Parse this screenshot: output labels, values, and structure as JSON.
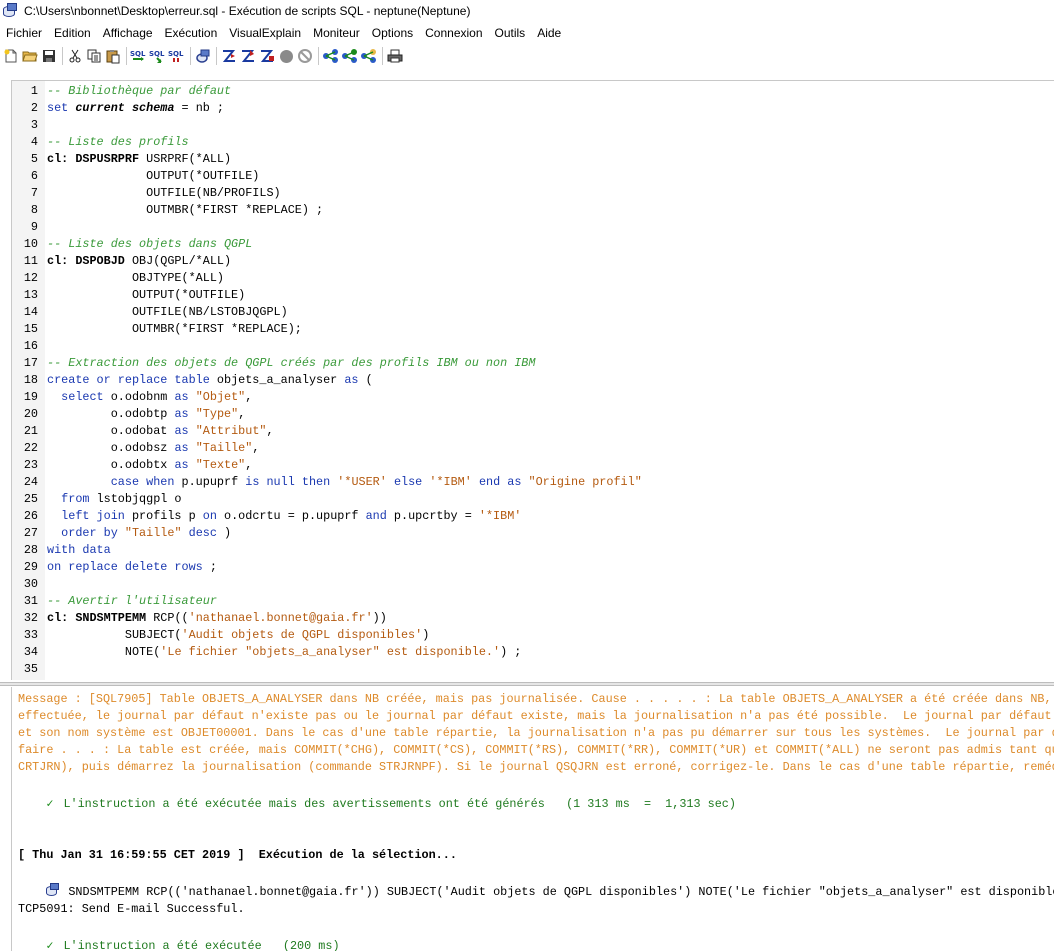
{
  "window": {
    "title": "C:\\Users\\nbonnet\\Desktop\\erreur.sql - Exécution de scripts SQL - neptune(Neptune)"
  },
  "menu": [
    "Fichier",
    "Edition",
    "Affichage",
    "Exécution",
    "VisualExplain",
    "Moniteur",
    "Options",
    "Connexion",
    "Outils",
    "Aide"
  ],
  "toolbar": {
    "sql_label": "SQL",
    "icons": [
      "new-file-icon",
      "open-folder-icon",
      "save-icon",
      "cut-icon",
      "copy-icon",
      "paste-icon",
      "run-all-icon",
      "run-from-selection-icon",
      "run-selected-icon",
      "connection-icon",
      "explain-icon",
      "explain-run-icon",
      "explain-selected-icon",
      "stop-icon",
      "cancel-icon",
      "visual-explain-icon",
      "visual-explain-run-icon",
      "visual-explain-selected-icon",
      "print-icon"
    ]
  },
  "editor": {
    "lines": [
      [
        [
          "cm",
          "-- Bibliothèque par défaut"
        ]
      ],
      [
        [
          "kw",
          "set "
        ],
        [
          "cl it bold",
          "current schema"
        ],
        [
          "tx",
          " = nb ;"
        ]
      ],
      [],
      [
        [
          "cm",
          "-- Liste des profils"
        ]
      ],
      [
        [
          "cl bold",
          "cl: DSPUSRPRF"
        ],
        [
          "tx",
          " USRPRF(*ALL)"
        ]
      ],
      [
        [
          "tx",
          "              OUTPUT(*OUTFILE)"
        ]
      ],
      [
        [
          "tx",
          "              OUTFILE(NB/PROFILS)"
        ]
      ],
      [
        [
          "tx",
          "              OUTMBR(*FIRST *REPLACE) ;"
        ]
      ],
      [],
      [
        [
          "cm",
          "-- Liste des objets dans QGPL"
        ]
      ],
      [
        [
          "cl bold",
          "cl: DSPOBJD"
        ],
        [
          "tx",
          " OBJ(QGPL/*ALL)"
        ]
      ],
      [
        [
          "tx",
          "            OBJTYPE(*ALL)"
        ]
      ],
      [
        [
          "tx",
          "            OUTPUT(*OUTFILE)"
        ]
      ],
      [
        [
          "tx",
          "            OUTFILE(NB/LSTOBJQGPL)"
        ]
      ],
      [
        [
          "tx",
          "            OUTMBR(*FIRST *REPLACE);"
        ]
      ],
      [],
      [
        [
          "cm",
          "-- Extraction des objets de QGPL créés par des profils IBM ou non IBM"
        ]
      ],
      [
        [
          "kw",
          "create or replace table"
        ],
        [
          "tx",
          " objets_a_analyser "
        ],
        [
          "kw",
          "as"
        ],
        [
          "tx",
          " ("
        ]
      ],
      [
        [
          "kw",
          "  select"
        ],
        [
          "tx",
          " o.odobnm "
        ],
        [
          "kw",
          "as"
        ],
        [
          "tx",
          " "
        ],
        [
          "st",
          "\"Objet\""
        ],
        [
          "tx",
          ","
        ]
      ],
      [
        [
          "tx",
          "         o.odobtp "
        ],
        [
          "kw",
          "as"
        ],
        [
          "tx",
          " "
        ],
        [
          "st",
          "\"Type\""
        ],
        [
          "tx",
          ","
        ]
      ],
      [
        [
          "tx",
          "         o.odobat "
        ],
        [
          "kw",
          "as"
        ],
        [
          "tx",
          " "
        ],
        [
          "st",
          "\"Attribut\""
        ],
        [
          "tx",
          ","
        ]
      ],
      [
        [
          "tx",
          "         o.odobsz "
        ],
        [
          "kw",
          "as"
        ],
        [
          "tx",
          " "
        ],
        [
          "st",
          "\"Taille\""
        ],
        [
          "tx",
          ","
        ]
      ],
      [
        [
          "tx",
          "         o.odobtx "
        ],
        [
          "kw",
          "as"
        ],
        [
          "tx",
          " "
        ],
        [
          "st",
          "\"Texte\""
        ],
        [
          "tx",
          ","
        ]
      ],
      [
        [
          "kw",
          "         case when"
        ],
        [
          "tx",
          " p.upuprf "
        ],
        [
          "kw",
          "is null then"
        ],
        [
          "tx",
          " "
        ],
        [
          "st",
          "'*USER'"
        ],
        [
          "tx",
          " "
        ],
        [
          "kw",
          "else"
        ],
        [
          "tx",
          " "
        ],
        [
          "st",
          "'*IBM'"
        ],
        [
          "tx",
          " "
        ],
        [
          "kw",
          "end as"
        ],
        [
          "tx",
          " "
        ],
        [
          "st",
          "\"Origine profil\""
        ]
      ],
      [
        [
          "kw",
          "  from"
        ],
        [
          "tx",
          " lstobjqgpl o"
        ]
      ],
      [
        [
          "kw",
          "  left join"
        ],
        [
          "tx",
          " profils p "
        ],
        [
          "kw",
          "on"
        ],
        [
          "tx",
          " o.odcrtu = p.upuprf "
        ],
        [
          "kw",
          "and"
        ],
        [
          "tx",
          " p.upcrtby = "
        ],
        [
          "st",
          "'*IBM'"
        ]
      ],
      [
        [
          "kw",
          "  order by"
        ],
        [
          "tx",
          " "
        ],
        [
          "st",
          "\"Taille\""
        ],
        [
          "tx",
          " "
        ],
        [
          "kw",
          "desc"
        ],
        [
          "tx",
          " )"
        ]
      ],
      [
        [
          "kw",
          "with data"
        ]
      ],
      [
        [
          "kw",
          "on replace delete rows"
        ],
        [
          "tx",
          " ;"
        ]
      ],
      [],
      [
        [
          "cm",
          "-- Avertir l'utilisateur"
        ]
      ],
      [
        [
          "cl bold",
          "cl: SNDSMTPEMM"
        ],
        [
          "tx",
          " RCP(("
        ],
        [
          "st",
          "'nathanael.bonnet@gaia.fr'"
        ],
        [
          "tx",
          "))"
        ]
      ],
      [
        [
          "tx",
          "           SUBJECT("
        ],
        [
          "st",
          "'Audit objets de QGPL disponibles'"
        ],
        [
          "tx",
          ")"
        ]
      ],
      [
        [
          "tx",
          "           NOTE("
        ],
        [
          "st",
          "'Le fichier \"objets_a_analyser\" est disponible.'"
        ],
        [
          "tx",
          ") ;"
        ]
      ],
      []
    ]
  },
  "results": {
    "warning_lines": [
      "Message : [SQL7905] Table OBJETS_A_ANALYSER dans NB créée, mais pas journalisée. Cause . . . . . : La table OBJETS_A_ANALYSER a été créée dans NB, mais",
      "effectuée, le journal par défaut n'existe pas ou le journal par défaut existe, mais la journalisation n'a pas été possible.  Le journal par défaut est",
      "et son nom système est OBJET00001. Dans le cas d'une table répartie, la journalisation n'a pas pu démarrer sur tous les systèmes.  Le journal par défaut",
      "faire . . . : La table est créée, mais COMMIT(*CHG), COMMIT(*CS), COMMIT(*RS), COMMIT(*RR), COMMIT(*UR) et COMMIT(*ALL) ne seront pas admis tant que",
      "CRTJRN), puis démarrez la journalisation (commande STRJRNPF). Si le journal QSQJRN est erroné, corrigez-le. Dans le cas d'une table répartie, remédiez"
    ],
    "success_warnings": "L'instruction a été exécutée mais des avertissements ont été générés   (1 313 ms  =  1,313 sec)",
    "timestamp_line": "[ Thu Jan 31 16:59:55 CET 2019 ]  Exécution de la sélection...",
    "command_line": "SNDSMTPEMM RCP(('nathanael.bonnet@gaia.fr')) SUBJECT('Audit objets de QGPL disponibles') NOTE('Le fichier \"objets_a_analyser\" est disponible.')",
    "tcp_line": "TCP5091: Send E-mail Successful.",
    "success_final": "L'instruction a été exécutée   (200 ms)"
  },
  "colors": {
    "comment": "#3a9a3a",
    "keyword": "#1a38b0",
    "string": "#b45a10",
    "warning": "#dd8a2a",
    "success": "#1f7a1f"
  }
}
